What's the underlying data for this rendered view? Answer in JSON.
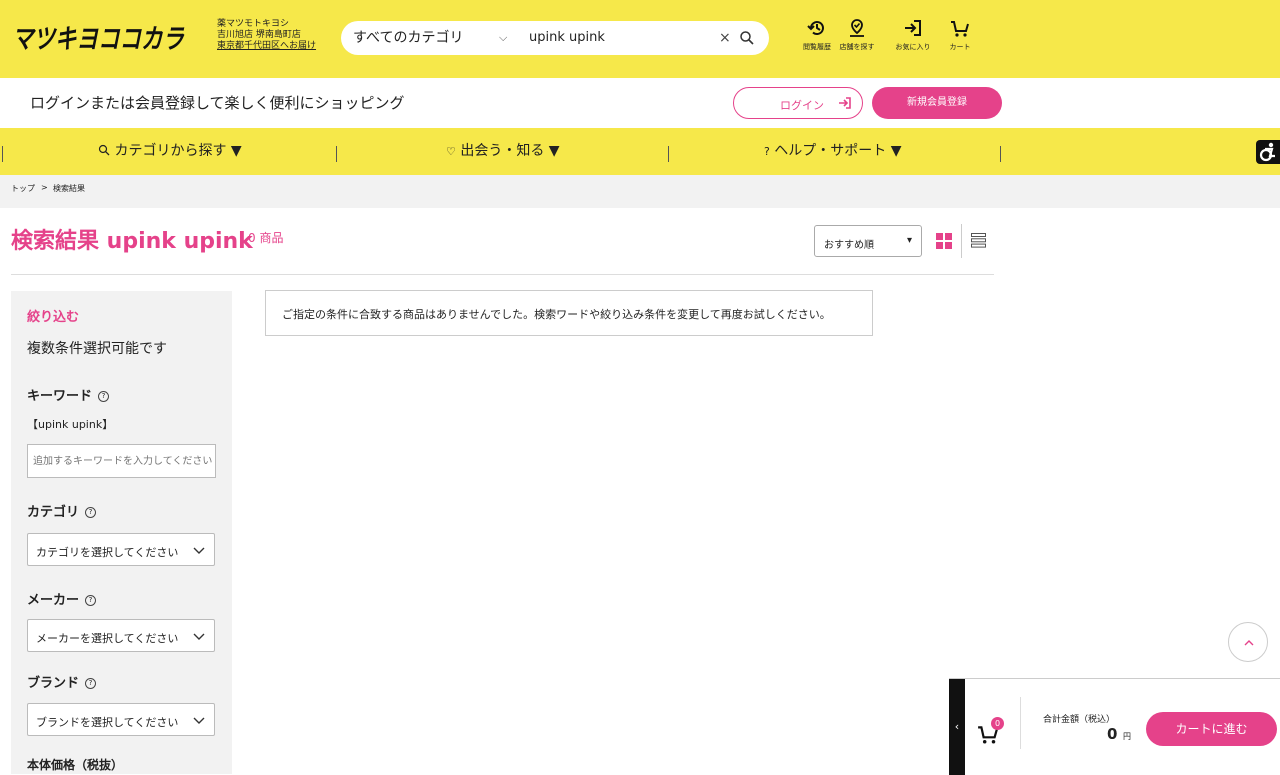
{
  "colors": {
    "brand_yellow": "#f6e84a",
    "accent_pink": "#e5428a",
    "breadcrumb_bg": "#f2f2f2"
  },
  "header": {
    "logo_text": "マツキヨココカラ",
    "store": {
      "line1": "薬マツモトキヨシ",
      "line2": "吉川旭店 堺南島町店",
      "delivery": "東京都千代田区へお届け"
    },
    "search": {
      "category": "すべてのカテゴリ",
      "query": "upink upink",
      "clear": "×"
    },
    "icons": [
      {
        "name": "history-icon",
        "label": "閲覧履歴"
      },
      {
        "name": "store-locator-icon",
        "label": "店舗を探す"
      },
      {
        "name": "favorites-icon",
        "label": "お気に入り"
      },
      {
        "name": "cart-icon",
        "label": "カート"
      }
    ]
  },
  "login_bar": {
    "message": "ログインまたは会員登録して楽しく便利にショッピング",
    "login": "ログイン",
    "register": "新規会員登録"
  },
  "nav": {
    "items": [
      "カテゴリから探す ▼",
      "出会う・知る ▼",
      "ヘルプ・サポート ▼"
    ]
  },
  "breadcrumb": {
    "home": "トップ",
    "sep": ">",
    "current": "検索結果"
  },
  "results": {
    "title": "検索結果 upink upink",
    "count": "0 商品",
    "sort": "おすすめ順",
    "empty_message": "ご指定の条件に合致する商品はありませんでした。検索ワードや絞り込み条件を変更して再度お試しください。"
  },
  "sidebar": {
    "title": "絞り込む",
    "subtitle": "複数条件選択可能です",
    "keyword": {
      "heading": "キーワード",
      "current": "【upink upink】",
      "placeholder": "追加するキーワードを入力してください"
    },
    "category": {
      "heading": "カテゴリ",
      "placeholder": "カテゴリを選択してください"
    },
    "maker": {
      "heading": "メーカー",
      "placeholder": "メーカーを選択してください"
    },
    "brand": {
      "heading": "ブランド",
      "placeholder": "ブランドを選択してください"
    },
    "price": {
      "heading": "本体価格（税抜）"
    }
  },
  "cart_widget": {
    "handle": "‹",
    "badge": "0",
    "total_label": "合計金額（税込）",
    "total": "0",
    "unit": "円",
    "proceed": "カートに進む"
  }
}
